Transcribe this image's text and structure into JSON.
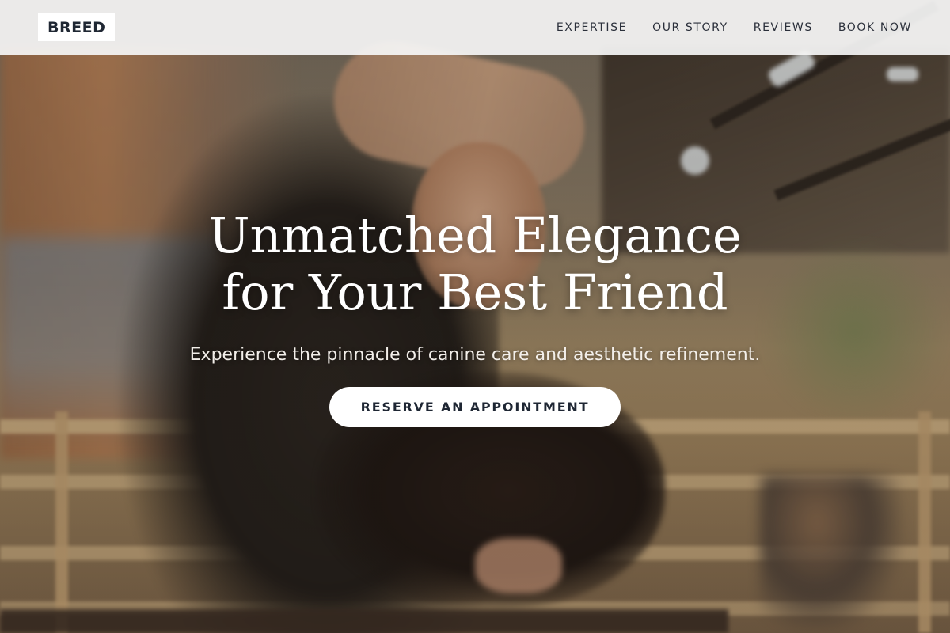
{
  "navbar": {
    "logo": "BREED",
    "links": [
      {
        "label": "EXPERTISE"
      },
      {
        "label": "OUR STORY"
      },
      {
        "label": "REVIEWS"
      },
      {
        "label": "BOOK NOW"
      }
    ]
  },
  "hero": {
    "title": "Unmatched Elegance for Your Best Friend",
    "subtitle": "Experience the pinnacle of canine care and aesthetic refinement.",
    "cta_label": "RESERVE AN APPOINTMENT"
  },
  "colors": {
    "navbar_bg": "#f6f6f6",
    "text_dark": "#1f2733",
    "button_bg": "#ffffff",
    "hero_text": "#ffffff"
  }
}
